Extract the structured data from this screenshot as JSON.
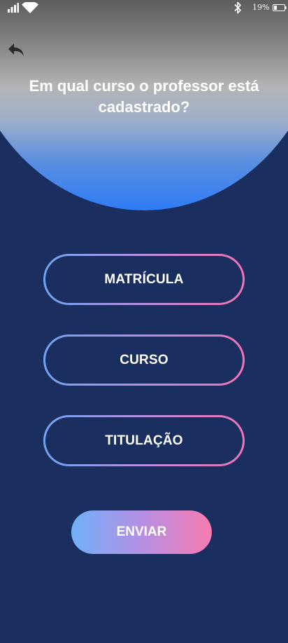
{
  "status_bar": {
    "battery_percent": "19%",
    "icons": [
      "signal-icon",
      "wifi-icon",
      "bluetooth-icon",
      "battery-icon"
    ]
  },
  "header": {
    "back_icon": "reply-arrow-icon",
    "question": "Em qual curso o professor está cadastrado?"
  },
  "options": [
    {
      "label": "MATRÍCULA"
    },
    {
      "label": "CURSO"
    },
    {
      "label": "TITULAÇÃO"
    }
  ],
  "submit": {
    "label": "ENVIAR"
  },
  "colors": {
    "background": "#1a2f60",
    "gradient_start": "#6fa4f2",
    "gradient_end": "#f173b7",
    "blob_bottom": "#2f7cf6",
    "text": "#ffffff"
  }
}
